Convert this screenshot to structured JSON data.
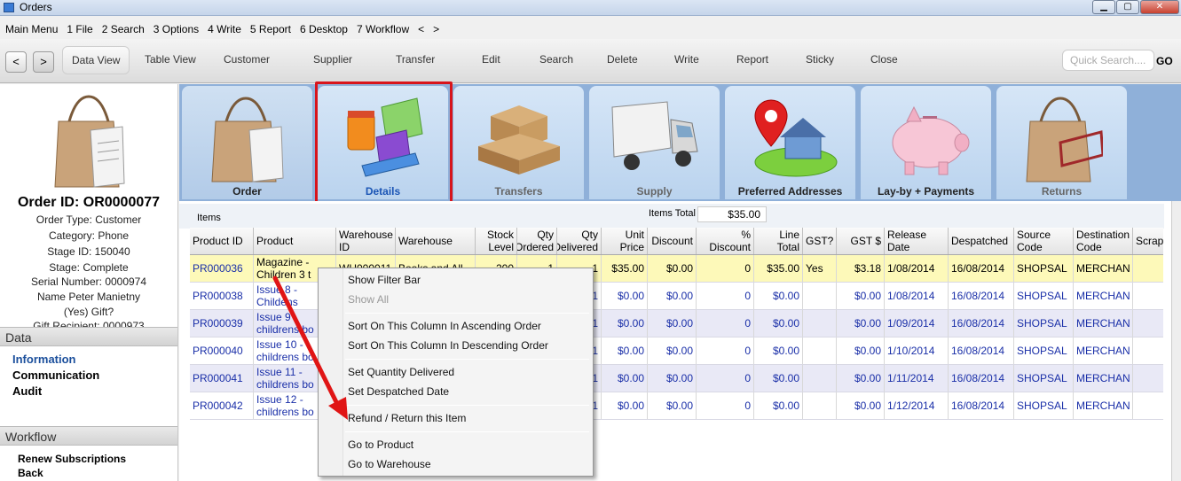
{
  "window": {
    "title": "Orders",
    "min": "▁",
    "max": "▢",
    "close": "✕"
  },
  "menu": [
    "Main Menu",
    "1 File",
    "2 Search",
    "3 Options",
    "4 Write",
    "5 Report",
    "6 Desktop",
    "7 Workflow",
    "<",
    ">"
  ],
  "toolbar": {
    "back": "<",
    "forward": ">",
    "buttons": [
      "Data View",
      "Table View",
      "Customer",
      "Supplier",
      "Transfer",
      "Edit",
      "Search",
      "Delete",
      "Write",
      "Report",
      "Sticky",
      "Close"
    ],
    "quick_search_placeholder": "Quick Search....",
    "go": "GO"
  },
  "left": {
    "order_id": "Order ID: OR0000077",
    "lines": [
      "Order Type: Customer",
      "Category: Phone",
      "Stage ID: 150040",
      "Stage: Complete",
      "Serial Number: 0000974",
      "Name Peter Manietny",
      "(Yes) Gift?",
      "Gift Recipient: 0000973"
    ],
    "data_header": "Data",
    "data_links": [
      "Information",
      "Communication",
      "Audit"
    ],
    "workflow_header": "Workflow",
    "workflow_links": [
      "Renew Subscriptions",
      "Back"
    ]
  },
  "tabs": [
    "Order",
    "Details",
    "Transfers",
    "Supply",
    "Preferred Addresses",
    "Lay-by + Payments",
    "Returns"
  ],
  "items": {
    "label": "Items",
    "total_label": "Items Total",
    "total_value": "$35.00"
  },
  "grid": {
    "headers": [
      "Product ID",
      "Product",
      "Warehouse ID",
      "Warehouse",
      "Stock Level",
      "Qty Ordered",
      "Qty Delivered",
      "Unit Price",
      "Discount",
      "% Discount",
      "Line Total",
      "GST?",
      "GST $",
      "Release Date",
      "Despatched",
      "Source Code",
      "Destination Code",
      "Scrap"
    ],
    "rows": [
      [
        "PR000036",
        "Magazine - Children 3 t",
        "WH000011",
        "Books and All",
        "200",
        "1",
        "1",
        "$35.00",
        "$0.00",
        "0",
        "$35.00",
        "Yes",
        "$3.18",
        "1/08/2014",
        "16/08/2014",
        "SHOPSAL",
        "MERCHAN"
      ],
      [
        "PR000038",
        "Issue 8 - Childens",
        "",
        "",
        "",
        "",
        "1",
        "$0.00",
        "$0.00",
        "0",
        "$0.00",
        "",
        "$0.00",
        "1/08/2014",
        "16/08/2014",
        "SHOPSAL",
        "MERCHAN"
      ],
      [
        "PR000039",
        "Issue 9 - childrens bo",
        "",
        "",
        "",
        "",
        "1",
        "$0.00",
        "$0.00",
        "0",
        "$0.00",
        "",
        "$0.00",
        "1/09/2014",
        "16/08/2014",
        "SHOPSAL",
        "MERCHAN"
      ],
      [
        "PR000040",
        "Issue 10 - childrens bo",
        "",
        "",
        "",
        "",
        "1",
        "$0.00",
        "$0.00",
        "0",
        "$0.00",
        "",
        "$0.00",
        "1/10/2014",
        "16/08/2014",
        "SHOPSAL",
        "MERCHAN"
      ],
      [
        "PR000041",
        "Issue 11 - childrens bo",
        "",
        "",
        "",
        "",
        "1",
        "$0.00",
        "$0.00",
        "0",
        "$0.00",
        "",
        "$0.00",
        "1/11/2014",
        "16/08/2014",
        "SHOPSAL",
        "MERCHAN"
      ],
      [
        "PR000042",
        "Issue 12 - childrens bo",
        "",
        "",
        "",
        "",
        "1",
        "$0.00",
        "$0.00",
        "0",
        "$0.00",
        "",
        "$0.00",
        "1/12/2014",
        "16/08/2014",
        "SHOPSAL",
        "MERCHAN"
      ]
    ]
  },
  "context_menu": {
    "items": [
      "Show Filter Bar",
      "Show All",
      "Sort On This Column In Ascending Order",
      "Sort On This Column In Descending Order",
      "Set Quantity Delivered",
      "Set Despatched Date",
      "Refund / Return this Item",
      "Go to Product",
      "Go to Warehouse"
    ]
  },
  "colors": {
    "highlight": "#d8141b",
    "accent_blue": "#1a2fa8",
    "tab_bg": "#bad3ee",
    "selected_row": "#fdf9b9"
  }
}
